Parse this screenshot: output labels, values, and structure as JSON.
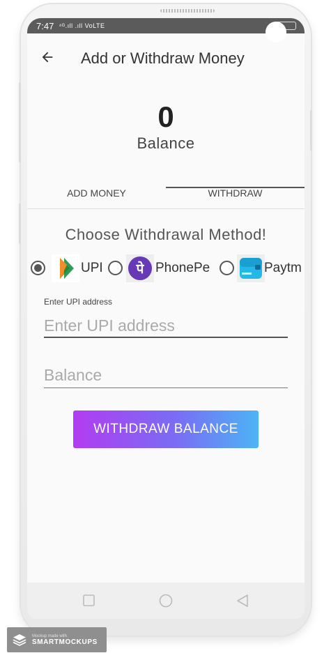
{
  "statusbar": {
    "time": "7:47",
    "signal_text": "⁴ᴳ.ıll .ıll VoLTE"
  },
  "appbar": {
    "title": "Add or Withdraw Money",
    "back_icon": "arrow-left-icon"
  },
  "balance": {
    "value": "0",
    "label": "Balance"
  },
  "tabs": [
    {
      "label": "ADD MONEY",
      "selected": false
    },
    {
      "label": "WITHDRAW",
      "selected": true
    }
  ],
  "withdraw": {
    "heading": "Choose Withdrawal Method!",
    "methods": [
      {
        "label": "UPI",
        "selected": true,
        "icon": "upi-logo-icon"
      },
      {
        "label": "PhonePe",
        "selected": false,
        "icon": "phonepe-logo-icon"
      },
      {
        "label": "Paytm",
        "selected": false,
        "icon": "paytm-logo-icon"
      }
    ],
    "upi_field": {
      "floating_label": "Enter UPI address",
      "placeholder": "Enter UPI address",
      "value": ""
    },
    "balance_field": {
      "placeholder": "Balance",
      "value": ""
    },
    "button_label": "WITHDRAW BALANCE"
  },
  "colors": {
    "button_gradient_start": "#b23cf2",
    "button_gradient_end": "#4cb4f6",
    "statusbar": "#5b5b5b",
    "tab_indicator": "#555555"
  },
  "navbar": {
    "icons": [
      "recents-square-icon",
      "home-circle-icon",
      "back-triangle-icon"
    ]
  },
  "watermark": {
    "small_text": "Mockup made with",
    "brand": "SMARTMOCKUPS"
  }
}
